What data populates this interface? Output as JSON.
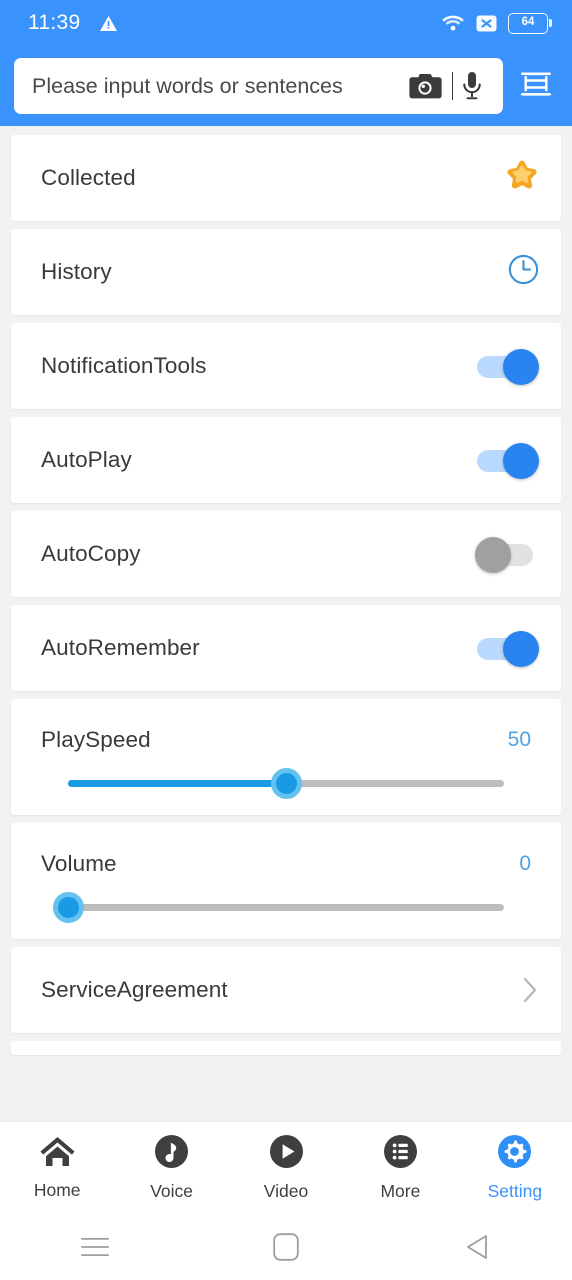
{
  "statusbar": {
    "time": "11:39",
    "warning_icon": "warning-triangle-icon",
    "wifi_icon": "wifi-icon",
    "no_sim_icon": "no-signal-x-icon",
    "battery_level": "64"
  },
  "search": {
    "placeholder": "Please input words or sentences",
    "value": "",
    "camera_icon": "camera-icon",
    "mic_icon": "microphone-icon",
    "menu_icon": "list-lines-icon"
  },
  "settings": {
    "rows": [
      {
        "label": "Collected",
        "type": "icon",
        "icon": "star-icon"
      },
      {
        "label": "History",
        "type": "icon",
        "icon": "clock-icon"
      },
      {
        "label": "NotificationTools",
        "type": "toggle",
        "state": "on"
      },
      {
        "label": "AutoPlay",
        "type": "toggle",
        "state": "on"
      },
      {
        "label": "AutoCopy",
        "type": "toggle",
        "state": "off"
      },
      {
        "label": "AutoRemember",
        "type": "toggle",
        "state": "on"
      },
      {
        "label": "PlaySpeed",
        "type": "slider",
        "value": "50",
        "percent": 50
      },
      {
        "label": "Volume",
        "type": "slider",
        "value": "0",
        "percent": 0
      },
      {
        "label": "ServiceAgreement",
        "type": "link",
        "icon": "chevron-right-icon"
      }
    ]
  },
  "bottomnav": {
    "items": [
      {
        "label": "Home",
        "icon": "home-icon",
        "active": false
      },
      {
        "label": "Voice",
        "icon": "music-note-circle-icon",
        "active": false
      },
      {
        "label": "Video",
        "icon": "play-circle-icon",
        "active": false
      },
      {
        "label": "More",
        "icon": "list-circle-icon",
        "active": false
      },
      {
        "label": "Setting",
        "icon": "gear-icon",
        "active": true
      }
    ]
  },
  "sysnav": {
    "recents_icon": "recents-menu-icon",
    "home_icon": "home-square-icon",
    "back_icon": "back-triangle-icon"
  },
  "colors": {
    "header_blue": "#3a93fd",
    "accent_blue": "#2a84f0",
    "slider_blue": "#1a9ae5",
    "star_orange": "#f7b32b",
    "page_bg": "#f2f2f2",
    "card_bg": "#ffffff"
  }
}
